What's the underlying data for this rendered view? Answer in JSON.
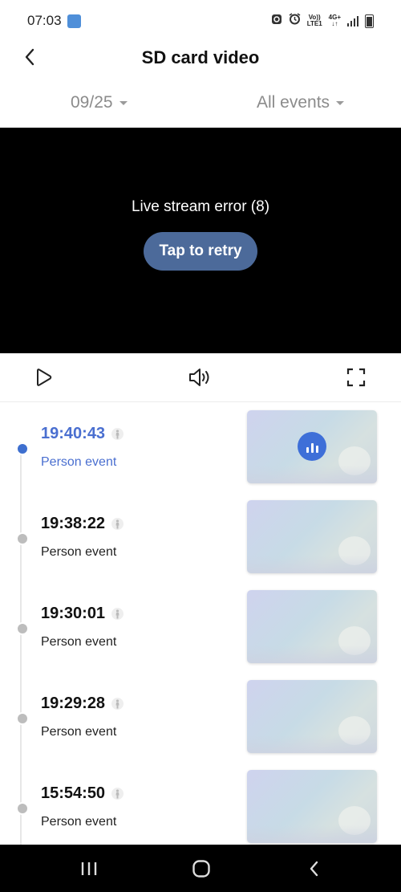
{
  "status_bar": {
    "time": "07:03",
    "volte": "Vo))",
    "lte": "LTE1",
    "net": "4G+",
    "net_arrows": "↓↑"
  },
  "header": {
    "title": "SD card video"
  },
  "filters": {
    "date": "09/25",
    "events": "All events"
  },
  "video": {
    "error_text": "Live stream error (8)",
    "retry_label": "Tap to retry"
  },
  "events": [
    {
      "time": "19:40:43",
      "label": "Person event",
      "active": true
    },
    {
      "time": "19:38:22",
      "label": "Person event",
      "active": false
    },
    {
      "time": "19:30:01",
      "label": "Person event",
      "active": false
    },
    {
      "time": "19:29:28",
      "label": "Person event",
      "active": false
    },
    {
      "time": "15:54:50",
      "label": "Person event",
      "active": false
    }
  ],
  "colors": {
    "accent": "#3e6fcf",
    "retry_button": "#4c6a9a",
    "video_bg": "#000000",
    "navbar_bg": "#000000"
  },
  "icons": {
    "back": "chevron-left-icon",
    "play": "play-icon",
    "sound": "speaker-icon",
    "fullscreen": "fullscreen-icon",
    "event_type": "person-icon",
    "playing": "equalizer-icon"
  }
}
